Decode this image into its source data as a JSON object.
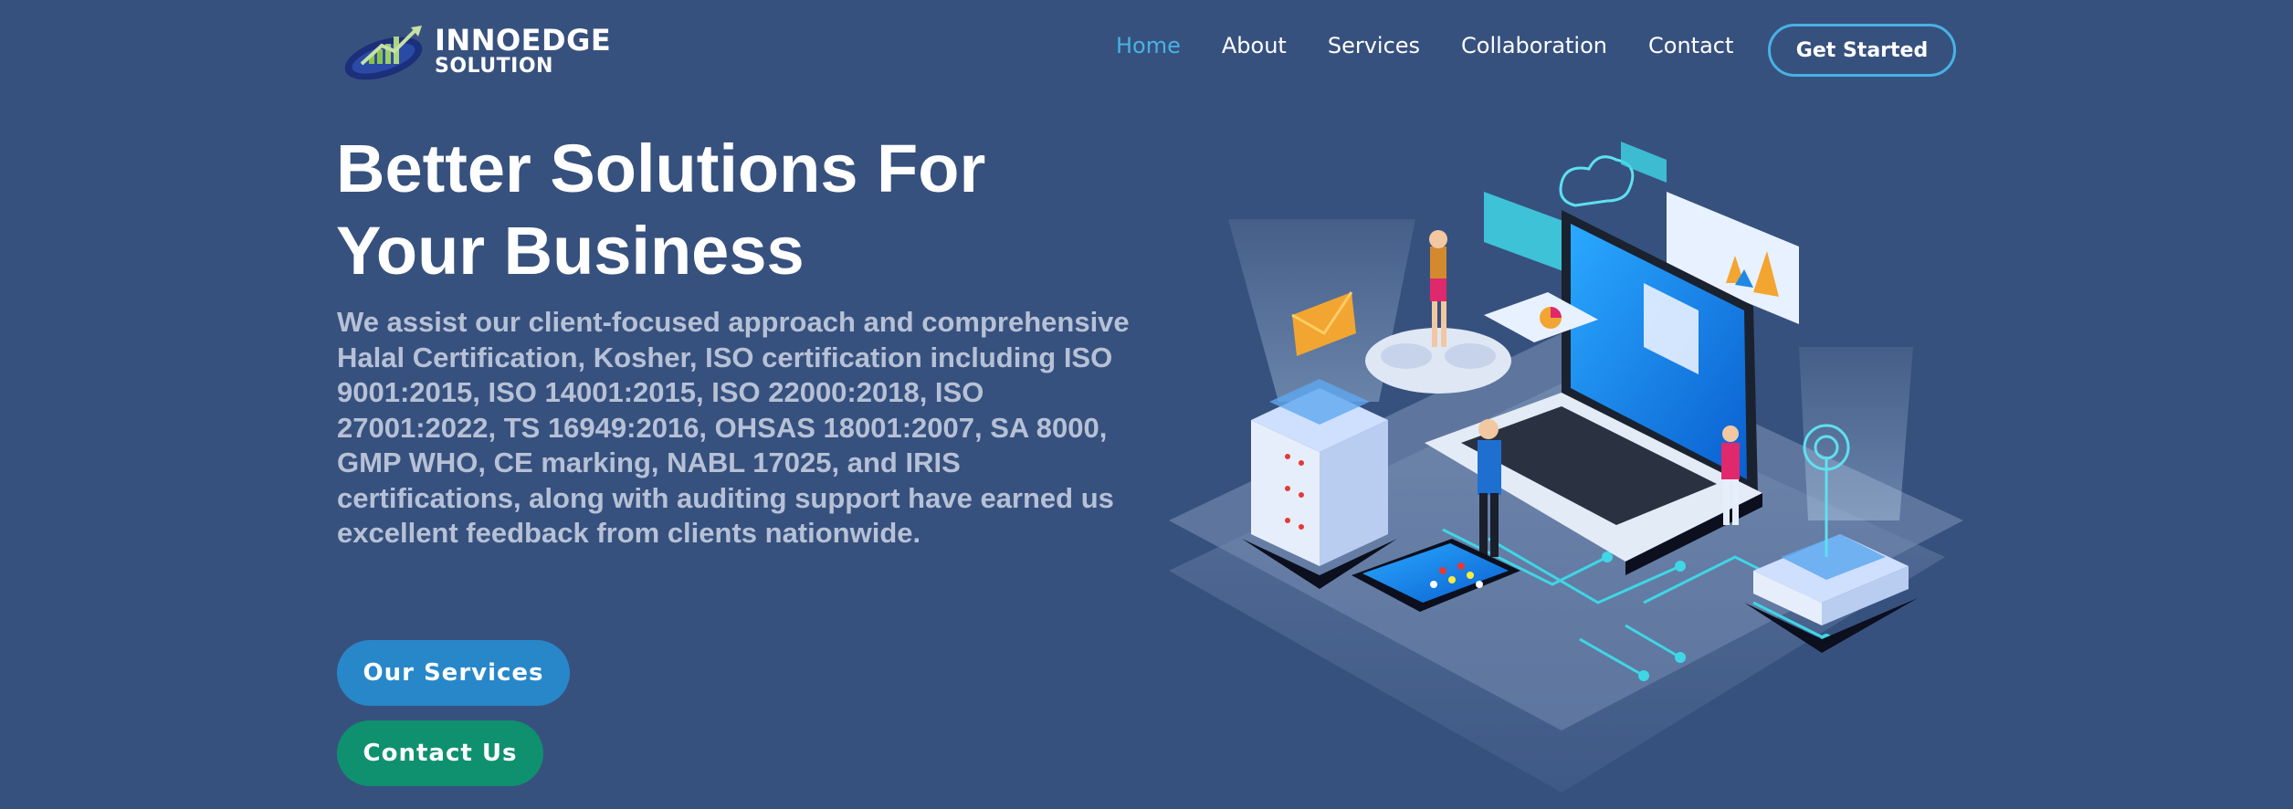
{
  "brand": {
    "name_line1": "INNOEDGE",
    "name_line2": "SOLUTION"
  },
  "nav": {
    "items": [
      {
        "label": "Home",
        "active": true
      },
      {
        "label": "About",
        "active": false
      },
      {
        "label": "Services",
        "active": false
      },
      {
        "label": "Collaboration",
        "active": false
      },
      {
        "label": "Contact",
        "active": false
      }
    ],
    "cta_label": "Get Started"
  },
  "hero": {
    "title_line1": "Better Solutions For",
    "title_line2": "Your Business",
    "description": "We assist our client-focused approach and comprehensive Halal Certification, Kosher, ISO certification including ISO 9001:2015, ISO 14001:2015, ISO 22000:2018, ISO 27001:2022, TS 16949:2016, OHSAS 18001:2007, SA 8000, GMP WHO, CE marking, NABL 17025, and IRIS certifications, along with auditing support have earned us excellent feedback from clients nationwide.",
    "primary_button": "Our Services",
    "secondary_button": "Contact Us"
  },
  "colors": {
    "background": "#37517e",
    "accent": "#47b2e4",
    "services_button": "#2787c9",
    "contact_button": "#0f9170",
    "description_text": "#b7c1d6"
  },
  "icons": {
    "logo": "growth-bars-logo-icon",
    "illustration": "isometric-tech-illustration"
  }
}
